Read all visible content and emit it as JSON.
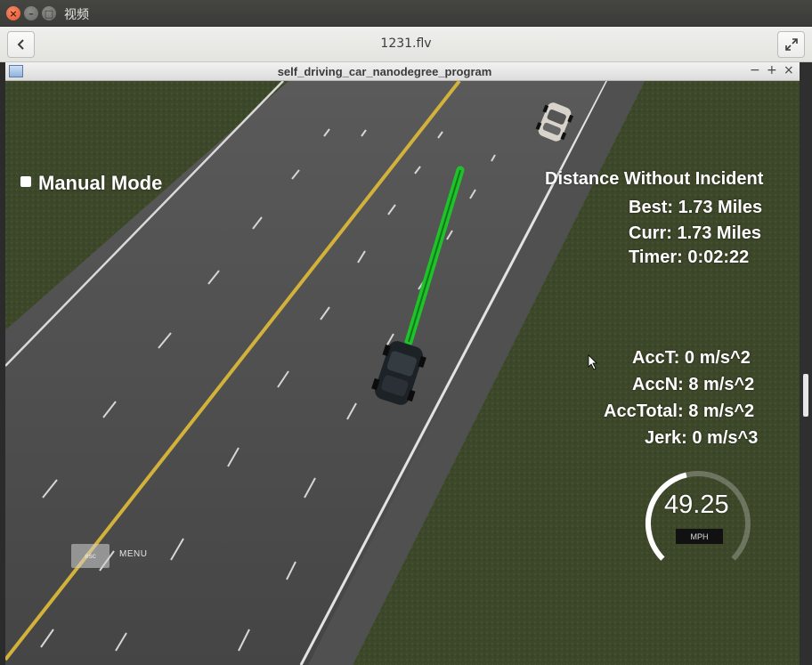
{
  "os_window": {
    "title": "视频",
    "buttons": {
      "close": "×",
      "minimize": "–",
      "maximize": "□"
    }
  },
  "player": {
    "file_title": "1231.flv",
    "back_icon": "chevron-left-icon",
    "fullscreen_icon": "expand-icon"
  },
  "sim_window": {
    "title": "self_driving_car_nanodegree_program",
    "controls": {
      "minimize": "−",
      "maximize": "+",
      "close": "×"
    }
  },
  "hud": {
    "manual_mode_label": "Manual Mode",
    "distance_heading": "Distance Without Incident",
    "best": "Best: 1.73 Miles",
    "curr": "Curr: 1.73 Miles",
    "timer": "Timer: 0:02:22",
    "acc_t": "AccT: 0 m/s^2",
    "acc_n": "AccN: 8 m/s^2",
    "acc_total": "AccTotal: 8 m/s^2",
    "jerk": "Jerk: 0 m/s^3",
    "speed_value": "49.25",
    "speed_unit": "MPH",
    "speedometer_fill": 0.45,
    "esc_label": "esc",
    "menu_label": "MENU"
  },
  "colors": {
    "grass": "#3f4a2c",
    "road": "#4a4a4a",
    "yellow_line": "#d2b23a",
    "path_green": "#1fc22a",
    "hud_text": "#ffffff"
  }
}
